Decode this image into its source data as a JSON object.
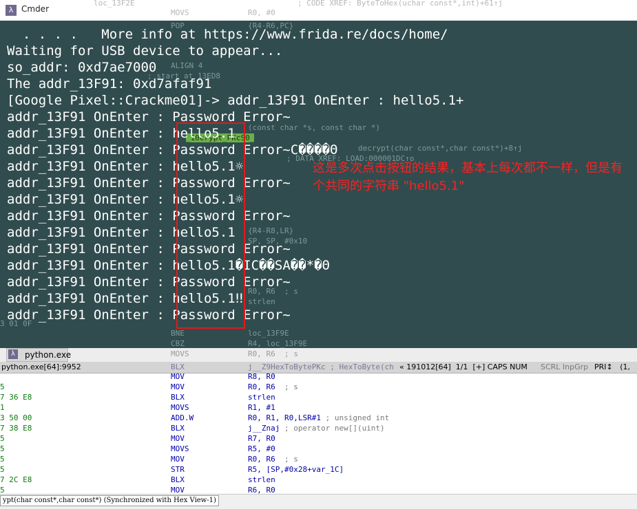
{
  "window": {
    "title": "Cmder",
    "logo_glyph": "λ",
    "tab_label": "python.exe",
    "status_process": "python.exe[64]:9952",
    "status_info": "« 191012[64]  1/1  [+] CAPS NUM",
    "status_dim": "SCRL InpGrp",
    "status_tail": "PRI↕   (1,"
  },
  "console": {
    "lines": [
      "  . . . .   More info at https://www.frida.re/docs/home/",
      "Waiting for USB device to appear...",
      "so_addr: 0xd7ae7000",
      "The addr_13F91: 0xd7afaf91",
      "[Google Pixel::Crackme01]-> addr_13F91 OnEnter : hello5.1+",
      "addr_13F91 OnEnter : Password Error~",
      "addr_13F91 OnEnter : hello5.1",
      "addr_13F91 OnEnter : Password Error~C����Θ",
      "addr_13F91 OnEnter : hello5.1☼",
      "addr_13F91 OnEnter : Password Error~",
      "addr_13F91 OnEnter : hello5.1☼",
      "addr_13F91 OnEnter : Password Error~",
      "addr_13F91 OnEnter : hello5.1",
      "addr_13F91 OnEnter : Password Error~",
      "addr_13F91 OnEnter : hello5.1�IC��SA��*�Θ",
      "addr_13F91 OnEnter : Password Error~",
      "addr_13F91 OnEnter : hello5.1‼",
      "addr_13F91 OnEnter : Password Error~"
    ],
    "annotation": "这是多次点击按钮的结果，基本上每次都不一样，但是有个共同的字符串 \"hello5.1\""
  },
  "ida_ghost": {
    "top_label": "loc_13F2E",
    "top_movs": "MOVS",
    "top_ops": "R0, #0",
    "top_comment": "; CODE XREF: ByteToHex(uchar const*,int)+61↑j",
    "pop": "POP",
    "pop_ops": "{R4-R6,PC}",
    "align": "ALIGN 4",
    "start_at": "; start at 13ED8",
    "fn_sig": "(const char *s, const char *)",
    "xref_decrypt": "decrypt(char const*,char const*)+8↑j",
    "data_xref": "; DATA XREF: LOAD:000001DC↑o",
    "label_cs0": "_10crypt_PKcS0_",
    "push_ops": "{R4-R8,LR}",
    "sub_ops": "SP, SP, #0x10",
    "strlen": "strlen",
    "r0r6": "R0, R6  ; s",
    "hex_01": "3 01 0F",
    "bne": "BNE",
    "bne_ops": "loc_13F9E",
    "cbz": "CBZ",
    "cbz_ops": "R4, loc_13F9E",
    "movs_r0r6": "R0, R6  ; s",
    "blx": "BLX",
    "blx_ops": "j__Z9HexToBytePKc ; HexToByte(ch"
  },
  "ida_lines": [
    {
      "hex": "",
      "mn": "MOV",
      "op": "R8, R0",
      "cm": ""
    },
    {
      "hex": "5",
      "mn": "MOV",
      "op": "R0, R6",
      "cm": "  ; s"
    },
    {
      "hex": "7 36 E8",
      "mn": "BLX",
      "op": "strlen",
      "cm": ""
    },
    {
      "hex": "1",
      "mn": "MOVS",
      "op": "R1, #1",
      "cm": ""
    },
    {
      "hex": "3 50 00",
      "mn": "ADD.W",
      "op": "R0, R1, R0,LSR#1",
      "cm": " ; unsigned int"
    },
    {
      "hex": "7 38 E8",
      "mn": "BLX",
      "op": "j__Znaj",
      "cm": " ; operator new[](uint)"
    },
    {
      "hex": "5",
      "mn": "MOV",
      "op": "R7, R0",
      "cm": ""
    },
    {
      "hex": "5",
      "mn": "MOVS",
      "op": "R5, #0",
      "cm": ""
    },
    {
      "hex": "5",
      "mn": "MOV",
      "op": "R0, R6",
      "cm": "  ; s"
    },
    {
      "hex": "5",
      "mn": "STR",
      "op": "R5, [SP,#0x28+var_1C]",
      "cm": ""
    },
    {
      "hex": "7 2C E8",
      "mn": "BLX",
      "op": "strlen",
      "cm": ""
    },
    {
      "hex": "5",
      "mn": "MOV",
      "op": "R6, R0",
      "cm": ""
    }
  ],
  "ida_bottom": "ypt(char const*,char const*) (Synchronized with Hex View-1)",
  "colors": {
    "console_bg": "#264245",
    "annotation": "#ff2020",
    "redbox": "#e01a1a"
  }
}
